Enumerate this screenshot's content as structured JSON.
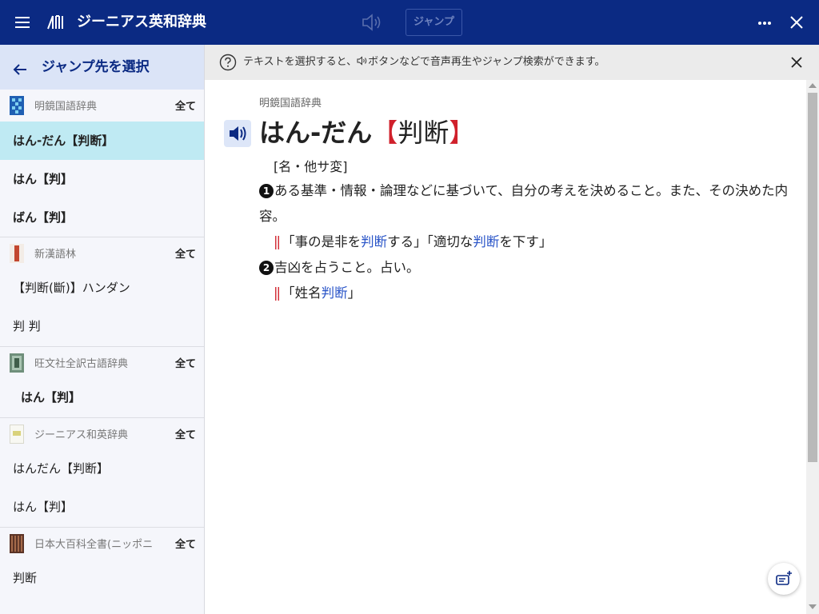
{
  "app": {
    "title": "ジーニアス英和辞典"
  },
  "toolbar": {
    "jump_label": "ジャンプ"
  },
  "sidebar": {
    "title": "ジャンプ先を選択",
    "groups": [
      {
        "name": "明鏡国語辞典",
        "all_label": "全て",
        "entries": [
          "はん-だん【判断】",
          "はん【判】",
          "ばん【判】"
        ]
      },
      {
        "name": "新漢語林",
        "all_label": "全て",
        "entries": [
          "【判断(斷)】ハンダン",
          "判 判"
        ]
      },
      {
        "name": "旺文社全訳古語辞典",
        "all_label": "全て",
        "entries": [
          "はん【判】"
        ]
      },
      {
        "name": "ジーニアス和英辞典",
        "all_label": "全て",
        "entries": [
          "はんだん【判断】",
          "はん【判】"
        ]
      },
      {
        "name": "日本大百科全書(ニッポニ",
        "all_label": "全て",
        "entries": [
          "判断"
        ]
      }
    ]
  },
  "info_bar": {
    "text_before": "テキストを選択すると、",
    "text_after": "ボタンなどで音声再生やジャンプ検索ができます。"
  },
  "entry": {
    "source": "明鏡国語辞典",
    "headword_kana": "はん-だん",
    "bracket_open": "【",
    "headword_kanji": "判断",
    "bracket_close": "】",
    "pos": "[名・他サ変]",
    "senses": [
      {
        "number": "1",
        "definition": "ある基準・情報・論理などに基づいて、自分の考えを決めること。また、その決めた内容。",
        "example_parts": [
          "「事の是非を",
          "判断",
          "する」「適切な",
          "判断",
          "を下す」"
        ]
      },
      {
        "number": "2",
        "definition": "吉凶を占うこと。占い。",
        "example_parts": [
          "「姓名",
          "判断",
          "」"
        ]
      }
    ]
  },
  "colors": {
    "header_bg": "#0b2a83",
    "selected_entry": "#bfeaf3",
    "accent_red": "#d0202b",
    "link_blue": "#2a55c8"
  }
}
